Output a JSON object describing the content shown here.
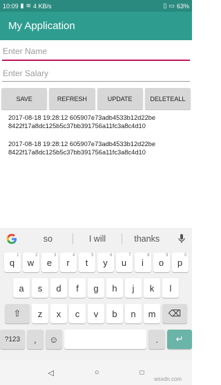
{
  "status": {
    "time": "10:09",
    "speed": "4 KB/s",
    "battery": "63%"
  },
  "app": {
    "title": "My Application"
  },
  "form": {
    "name_placeholder": "Enter Name",
    "salary_placeholder": "Enter Salary"
  },
  "buttons": {
    "save": "SAVE",
    "refresh": "REFRESH",
    "update": "UPDATE",
    "deleteall": "DELETEALL"
  },
  "records": [
    "2017-08-18 19:28:12 605907e73adb4533b12d22be 8422f17a8dc125b5c37bb391756a11fc3a8c4d10",
    "2017-08-18 19:28:12 605907e73adb4533b12d22be 8422f17a8dc125b5c37bb391756a11fc3a8c4d10"
  ],
  "keyboard": {
    "suggestions": [
      "so",
      "I will",
      "thanks"
    ],
    "row1": [
      {
        "k": "q",
        "n": "1"
      },
      {
        "k": "w",
        "n": "2"
      },
      {
        "k": "e",
        "n": "3"
      },
      {
        "k": "r",
        "n": "4"
      },
      {
        "k": "t",
        "n": "5"
      },
      {
        "k": "y",
        "n": "6"
      },
      {
        "k": "u",
        "n": "7"
      },
      {
        "k": "i",
        "n": "8"
      },
      {
        "k": "o",
        "n": "9"
      },
      {
        "k": "p",
        "n": "0"
      }
    ],
    "row2": [
      "a",
      "s",
      "d",
      "f",
      "g",
      "h",
      "j",
      "k",
      "l"
    ],
    "row3": [
      "z",
      "x",
      "c",
      "v",
      "b",
      "n",
      "m"
    ],
    "symbols": "?123",
    "comma": ",",
    "period": "."
  },
  "watermark": "wsxdn.com"
}
